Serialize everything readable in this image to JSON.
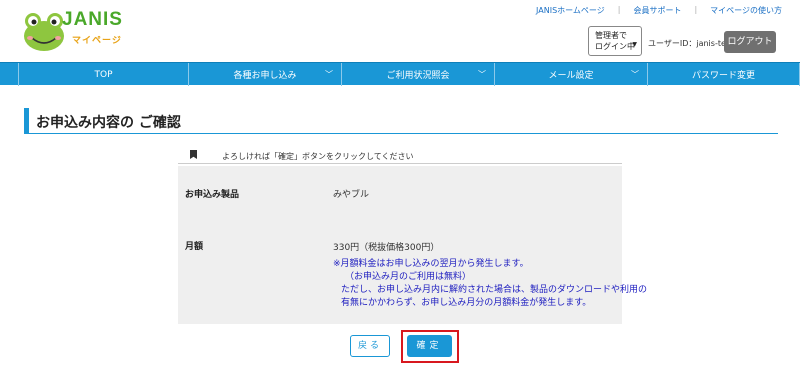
{
  "header": {
    "logo_text": "JANIS",
    "logo_sub": "マイページ",
    "links": [
      "JANISホームページ",
      "会員サポート",
      "マイページの使い方"
    ],
    "admin_select": [
      "管理者で",
      "ログイン中"
    ],
    "user_id": "ユーザーID：janis-test",
    "logout": "ログアウト"
  },
  "nav": {
    "items": [
      {
        "label": "TOP",
        "has_dropdown": false
      },
      {
        "label": "各種お申し込み",
        "has_dropdown": true
      },
      {
        "label": "ご利用状況照会",
        "has_dropdown": true
      },
      {
        "label": "メール設定",
        "has_dropdown": true
      },
      {
        "label": "パスワード変更",
        "has_dropdown": false
      }
    ]
  },
  "page": {
    "title": "お申込み内容の ご確認",
    "notice": "よろしければ「確定」ボタンをクリックしてください"
  },
  "details": {
    "product_label": "お申込み製品",
    "product_value": "みやブル",
    "monthly_label": "月額",
    "monthly_value": "330円（税抜価格300円）",
    "notes": [
      "※月額料金はお申し込みの翌月から発生します。",
      "（お申込み月のご利用は無料）",
      "ただし、お申し込み月内に解約された場合は、製品のダウンロードや利用の",
      "有無にかかわらず、お申し込み月分の月額料金が発生します。"
    ]
  },
  "buttons": {
    "back": "戻る",
    "confirm": "確定"
  },
  "colors": {
    "primary": "#1a97d6",
    "highlight": "#d8181f",
    "logo_green": "#4aa82a",
    "note_text": "#2020c0"
  }
}
